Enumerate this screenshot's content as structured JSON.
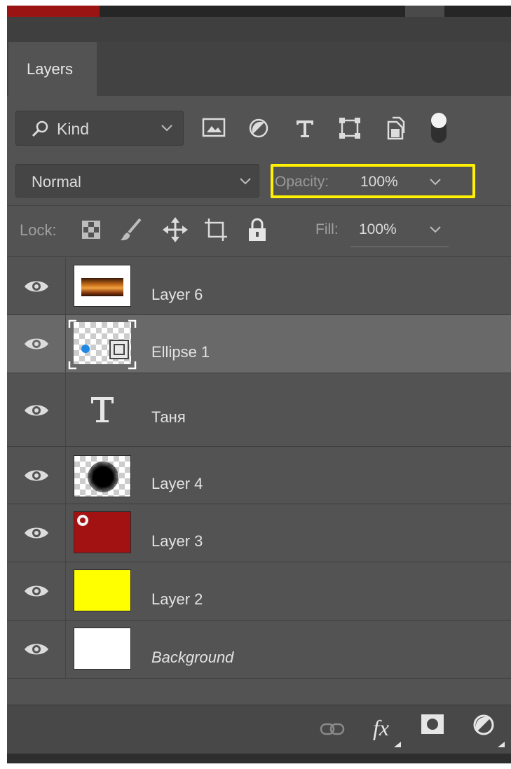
{
  "panel": {
    "tab_label": "Layers"
  },
  "filter": {
    "kind_label": "Kind",
    "icons": [
      "image-filter-icon",
      "adjustment-filter-icon",
      "type-filter-icon",
      "shape-filter-icon",
      "smart-object-filter-icon",
      "filter-toggle-icon"
    ]
  },
  "blend": {
    "mode": "Normal",
    "opacity_label": "Opacity:",
    "opacity_value": "100%",
    "highlight_color": "#fff200"
  },
  "lock": {
    "label": "Lock:",
    "icons": [
      "lock-transparent-pixels-icon",
      "lock-image-pixels-icon",
      "lock-position-icon",
      "lock-artboard-icon",
      "lock-all-icon"
    ],
    "fill_label": "Fill:",
    "fill_value": "100%"
  },
  "layers": [
    {
      "name": "Layer 6",
      "thumb": "image",
      "selected": false,
      "italic": false
    },
    {
      "name": "Ellipse 1",
      "thumb": "shape",
      "selected": true,
      "italic": false
    },
    {
      "name": "Таня",
      "thumb": "type",
      "selected": false,
      "italic": false
    },
    {
      "name": "Layer 4",
      "thumb": "black-circle",
      "selected": false,
      "italic": false
    },
    {
      "name": "Layer 3",
      "thumb": "red",
      "selected": false,
      "italic": false
    },
    {
      "name": "Layer 2",
      "thumb": "yellow",
      "selected": false,
      "italic": false
    },
    {
      "name": "Background",
      "thumb": "white",
      "selected": false,
      "italic": true
    }
  ],
  "colors": {
    "layer3_fill": "#a31212",
    "layer2_fill": "#ffff00",
    "selection_blue": "#1e88e5"
  },
  "bottom_bar": {
    "fx_label": "fx",
    "icons": [
      "link-layers-icon",
      "layer-style-icon",
      "add-mask-icon",
      "adjustment-layer-icon"
    ]
  }
}
